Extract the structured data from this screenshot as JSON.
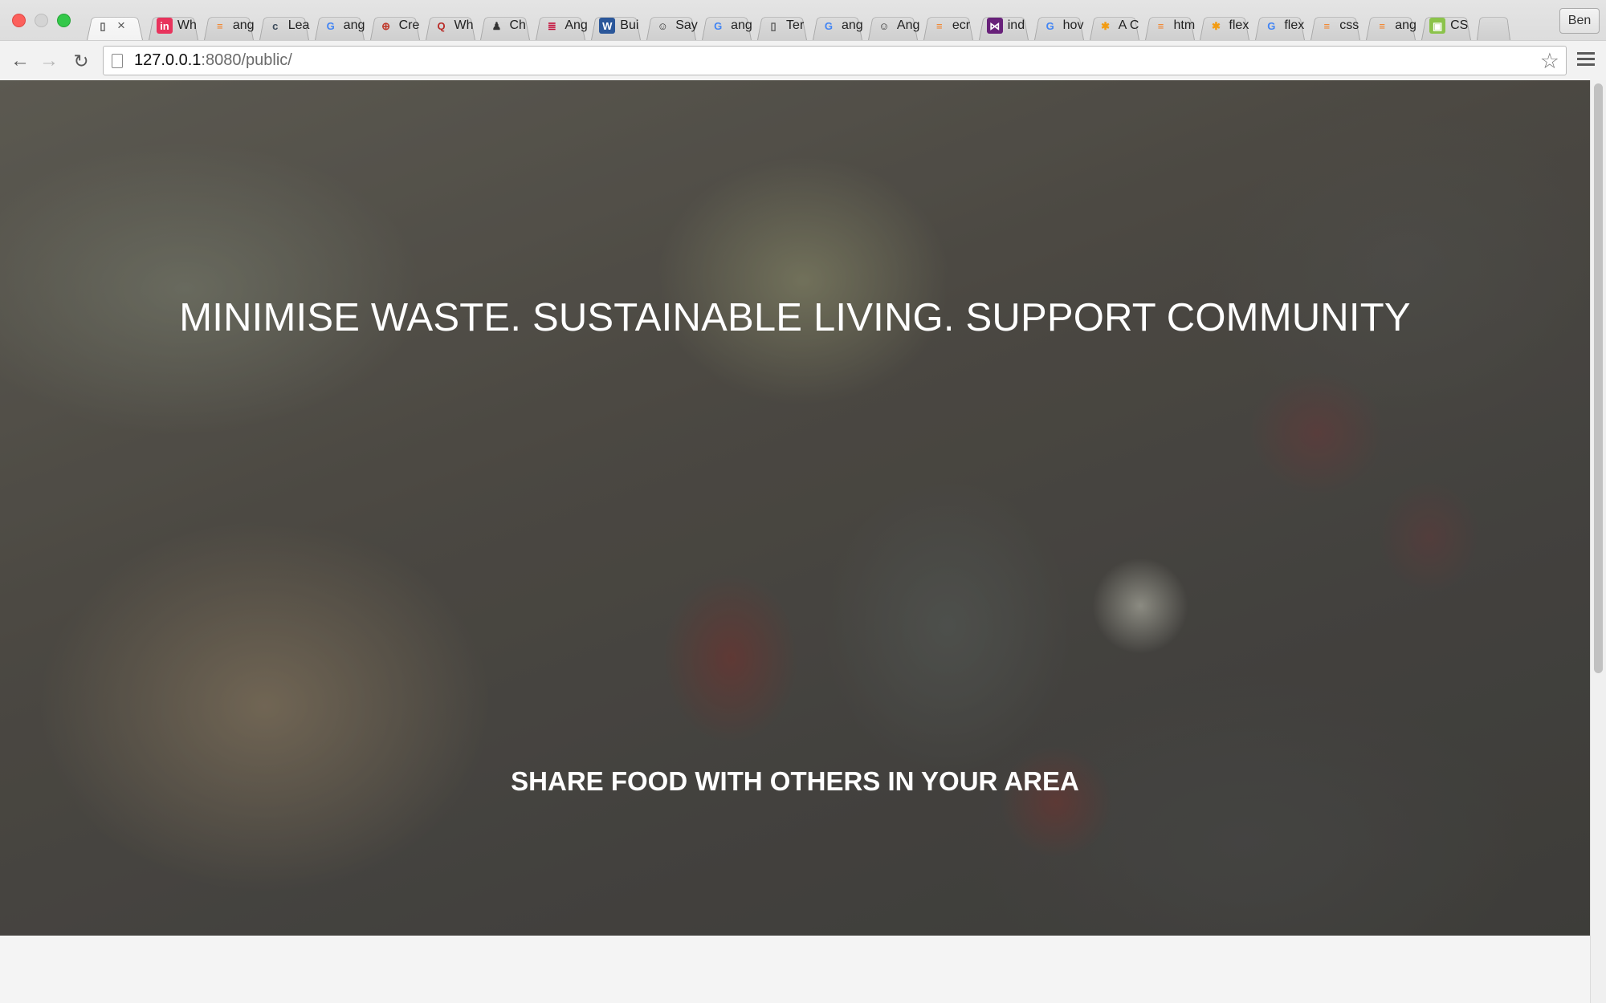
{
  "browser": {
    "profile_name": "Ben",
    "url_host": "127.0.0.1",
    "url_path": ":8080/public/",
    "tabs": [
      {
        "title": "",
        "icon": "page-icon",
        "glyph": "▯",
        "bg": "transparent",
        "fg": "#555",
        "active": true
      },
      {
        "title": "Wh",
        "icon": "invision-icon",
        "glyph": "in",
        "bg": "#e8335c",
        "fg": "#ffffff"
      },
      {
        "title": "ang",
        "icon": "stackoverflow-icon",
        "glyph": "≡",
        "bg": "transparent",
        "fg": "#f48024"
      },
      {
        "title": "Lea",
        "icon": "codeschool-icon",
        "glyph": "c",
        "bg": "transparent",
        "fg": "#3b4a5a"
      },
      {
        "title": "ang",
        "icon": "google-icon",
        "glyph": "G",
        "bg": "transparent",
        "fg": "#4285f4"
      },
      {
        "title": "Cre",
        "icon": "eventbrite-icon",
        "glyph": "⊕",
        "bg": "transparent",
        "fg": "#c0392b"
      },
      {
        "title": "Wh",
        "icon": "quora-icon",
        "glyph": "Q",
        "bg": "transparent",
        "fg": "#b92b27"
      },
      {
        "title": "Ch",
        "icon": "user-silhouette-icon",
        "glyph": "♟",
        "bg": "transparent",
        "fg": "#333333"
      },
      {
        "title": "Ang",
        "icon": "angular-doc-icon",
        "glyph": "≣",
        "bg": "transparent",
        "fg": "#c3002f"
      },
      {
        "title": "Bui",
        "icon": "word-icon",
        "glyph": "W",
        "bg": "#2b579a",
        "fg": "#ffffff"
      },
      {
        "title": "Say",
        "icon": "octocat-icon",
        "glyph": "☺",
        "bg": "transparent",
        "fg": "#333333"
      },
      {
        "title": "ang",
        "icon": "google-icon",
        "glyph": "G",
        "bg": "transparent",
        "fg": "#4285f4"
      },
      {
        "title": "Ter",
        "icon": "page-icon",
        "glyph": "▯",
        "bg": "transparent",
        "fg": "#555555"
      },
      {
        "title": "ang",
        "icon": "google-icon",
        "glyph": "G",
        "bg": "transparent",
        "fg": "#4285f4"
      },
      {
        "title": "Ang",
        "icon": "octocat-icon",
        "glyph": "☺",
        "bg": "transparent",
        "fg": "#333333"
      },
      {
        "title": "ecr",
        "icon": "stackoverflow-icon",
        "glyph": "≡",
        "bg": "transparent",
        "fg": "#f48024"
      },
      {
        "title": "ind",
        "icon": "visualstudio-icon",
        "glyph": "⋈",
        "bg": "#68217a",
        "fg": "#ffffff"
      },
      {
        "title": "hov",
        "icon": "google-icon",
        "glyph": "G",
        "bg": "transparent",
        "fg": "#4285f4"
      },
      {
        "title": "A C",
        "icon": "asterisk-icon",
        "glyph": "✱",
        "bg": "transparent",
        "fg": "#f39c12"
      },
      {
        "title": "htm",
        "icon": "stackoverflow-icon",
        "glyph": "≡",
        "bg": "transparent",
        "fg": "#f48024"
      },
      {
        "title": "flex",
        "icon": "asterisk-icon",
        "glyph": "✱",
        "bg": "transparent",
        "fg": "#f39c12"
      },
      {
        "title": "flex",
        "icon": "google-icon",
        "glyph": "G",
        "bg": "transparent",
        "fg": "#4285f4"
      },
      {
        "title": "css",
        "icon": "stackoverflow-icon",
        "glyph": "≡",
        "bg": "transparent",
        "fg": "#f48024"
      },
      {
        "title": "ang",
        "icon": "stackoverflow-icon",
        "glyph": "≡",
        "bg": "transparent",
        "fg": "#f48024"
      },
      {
        "title": "CS",
        "icon": "caniuse-icon",
        "glyph": "▣",
        "bg": "#8bc34a",
        "fg": "#ffffff"
      }
    ]
  },
  "page": {
    "headline": "MINIMISE WASTE. SUSTAINABLE LIVING. SUPPORT COMMUNITY",
    "subline": "SHARE FOOD WITH OTHERS IN YOUR AREA"
  },
  "colors": {
    "headline_text": "#ffffff",
    "page_background": "#f4f4f4"
  }
}
